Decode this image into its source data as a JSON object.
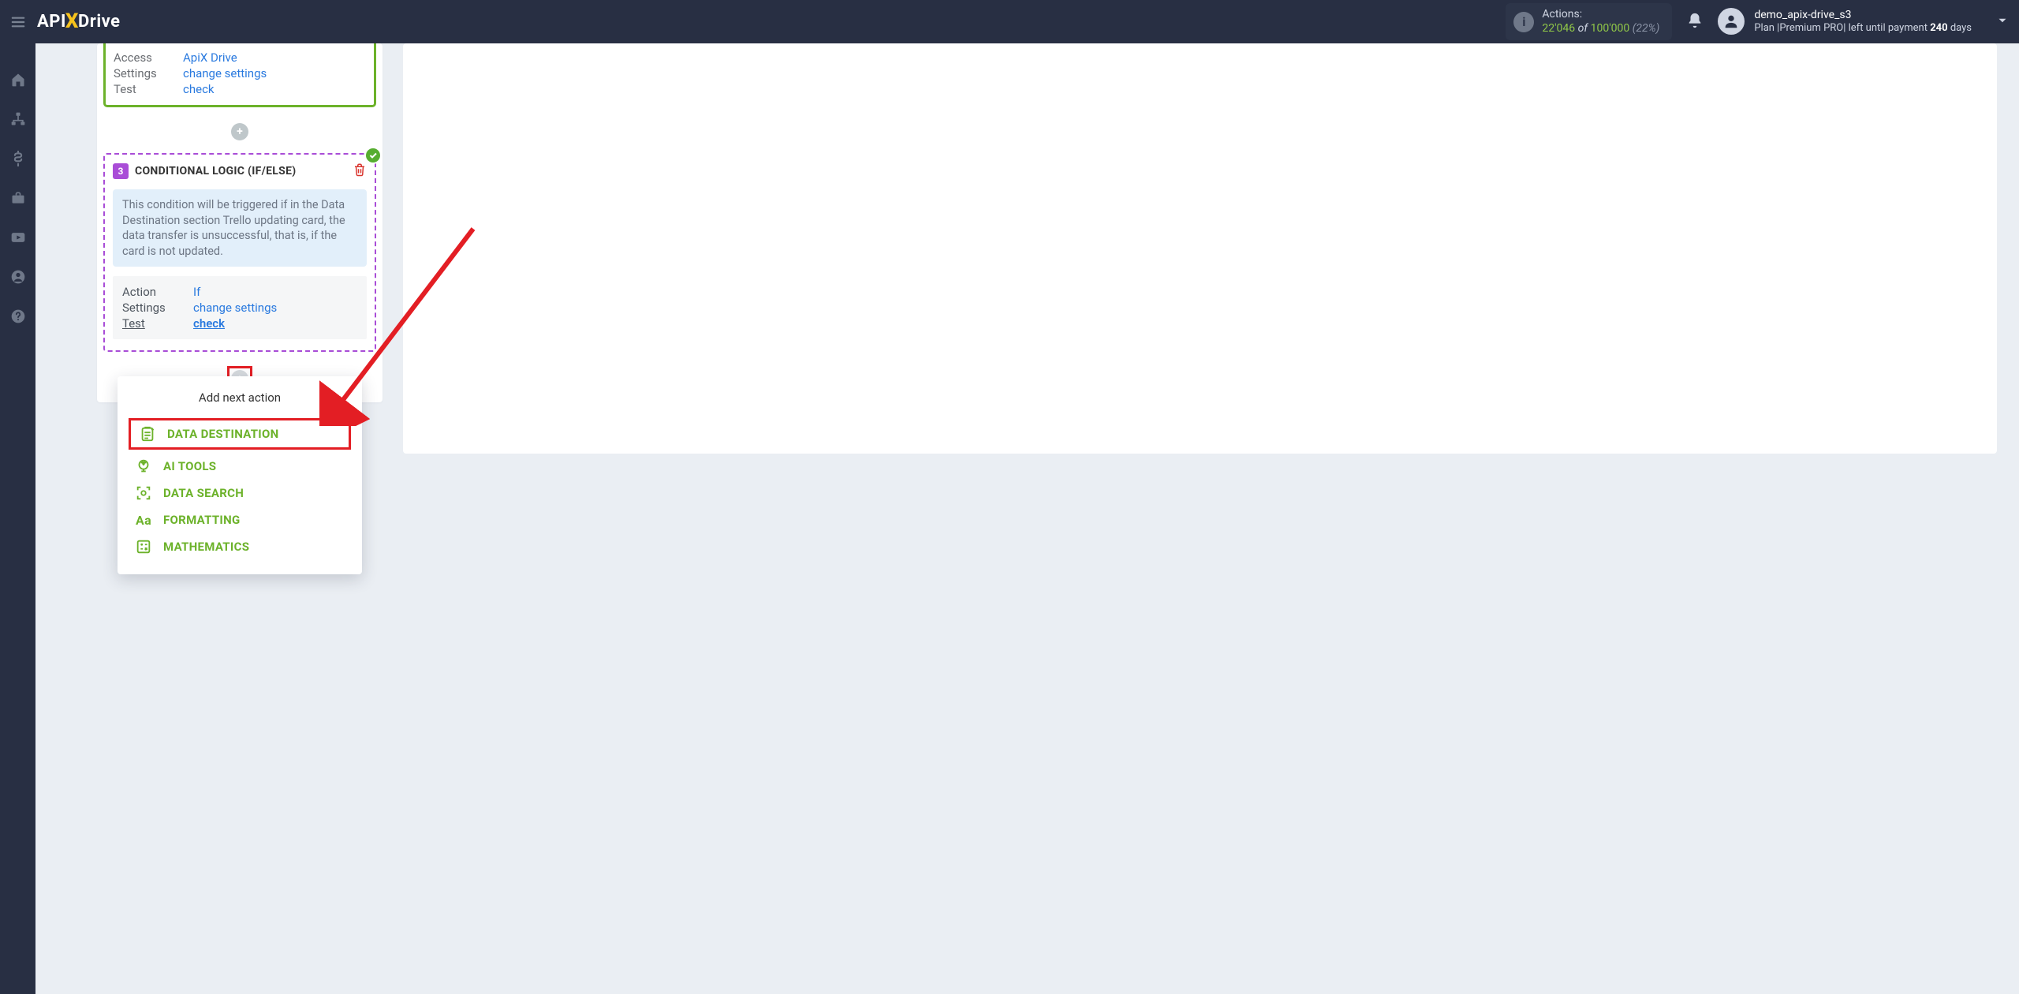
{
  "header": {
    "logo_prefix": "API",
    "logo_x": "X",
    "logo_suffix": "Drive",
    "actions_label": "Actions:",
    "actions_used": "22'046",
    "actions_of": "of",
    "actions_total": "100'000",
    "actions_pct": "(22%)",
    "user_name": "demo_apix-drive_s3",
    "plan_prefix": "Plan |Premium PRO| left until payment ",
    "plan_days": "240",
    "plan_days_suffix": " days"
  },
  "card_source": {
    "rows": [
      {
        "k": "Access",
        "v": "ApiX Drive"
      },
      {
        "k": "Settings",
        "v": "change settings"
      },
      {
        "k": "Test",
        "v": "check"
      }
    ]
  },
  "card_cond": {
    "step": "3",
    "title": "CONDITIONAL LOGIC (IF/ELSE)",
    "info": "This condition will be triggered if in the Data Destination section Trello updating card, the data transfer is unsuccessful, that is, if the card is not updated.",
    "rows": [
      {
        "k": "Action",
        "v": "If",
        "ku": false,
        "vu": false
      },
      {
        "k": "Settings",
        "v": "change settings",
        "ku": false,
        "vu": false
      },
      {
        "k": "Test",
        "v": "check",
        "ku": true,
        "vu": true
      }
    ]
  },
  "popup": {
    "title": "Add next action",
    "items": [
      {
        "label": "DATA DESTINATION",
        "icon": "clipboard-icon",
        "highlight": true
      },
      {
        "label": "AI TOOLS",
        "icon": "brain-icon",
        "highlight": false
      },
      {
        "label": "DATA SEARCH",
        "icon": "scan-icon",
        "highlight": false
      },
      {
        "label": "FORMATTING",
        "icon": "aa-icon",
        "highlight": false
      },
      {
        "label": "MATHEMATICS",
        "icon": "calc-icon",
        "highlight": false
      }
    ]
  }
}
